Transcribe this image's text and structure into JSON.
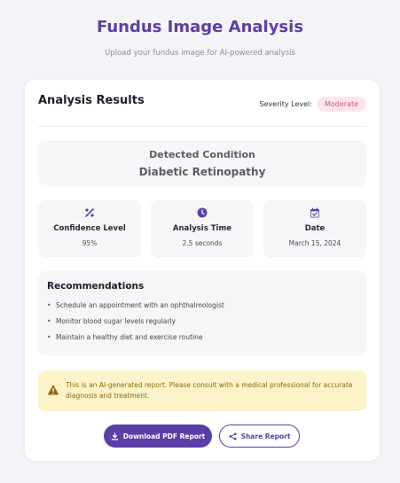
{
  "page": {
    "title": "Fundus Image Analysis",
    "subtitle": "Upload your fundus image for AI-powered analysis"
  },
  "results": {
    "title": "Analysis Results",
    "severity_label": "Severity Level:",
    "severity_value": "Moderate",
    "detected_label": "Detected Condition",
    "detected_value": "Diabetic Retinopathy"
  },
  "stats": [
    {
      "icon": "percent-icon",
      "label": "Confidence Level",
      "value": "95%"
    },
    {
      "icon": "clock-icon",
      "label": "Analysis Time",
      "value": "2.5 seconds"
    },
    {
      "icon": "calendar-icon",
      "label": "Date",
      "value": "March 15, 2024"
    }
  ],
  "recommendations": {
    "title": "Recommendations",
    "items": [
      "Schedule an appointment with an ophthalmologist",
      "Monitor blood sugar levels regularly",
      "Maintain a healthy diet and exercise routine"
    ]
  },
  "warning": {
    "icon": "warning-icon",
    "text": "This is an AI-generated report. Please consult with a medical professional for accurate diagnosis and treatment."
  },
  "actions": {
    "download_label": "Download PDF Report",
    "download_icon": "download-icon",
    "share_label": "Share Report",
    "share_icon": "share-icon"
  },
  "colors": {
    "accent": "#5b3fa8",
    "severity_bg": "#fde6e8",
    "severity_text": "#d9506a",
    "warning_bg": "#fdf3c9"
  }
}
